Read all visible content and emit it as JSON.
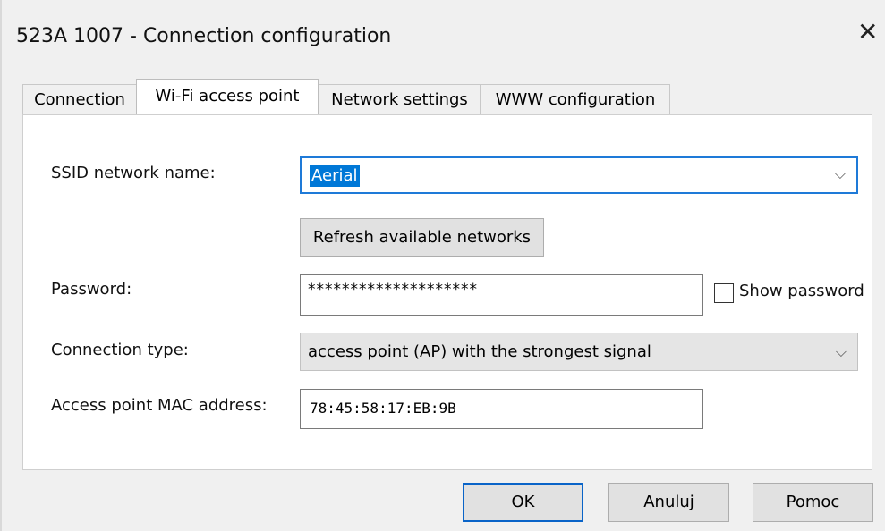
{
  "window": {
    "title": "523A 1007 - Connection configuration",
    "close_icon": "close-icon"
  },
  "tabs": [
    {
      "label": "Connection",
      "active": false
    },
    {
      "label": "Wi-Fi access point",
      "active": true
    },
    {
      "label": "Network settings",
      "active": false
    },
    {
      "label": "WWW configuration",
      "active": false
    }
  ],
  "form": {
    "ssid": {
      "label": "SSID network name:",
      "value": "Aerial"
    },
    "refresh_label": "Refresh available networks",
    "password": {
      "label": "Password:",
      "value": "********************"
    },
    "show_password": {
      "label": "Show password",
      "checked": false
    },
    "connection_type": {
      "label": "Connection type:",
      "value": "access point (AP) with the strongest signal"
    },
    "mac": {
      "label": "Access point MAC address:",
      "value": "78:45:58:17:EB:9B"
    }
  },
  "buttons": {
    "ok": "OK",
    "cancel": "Anuluj",
    "help": "Pomoc"
  },
  "colors": {
    "selection": "#0078d7",
    "focus_border": "#1e7ad8",
    "default_button_border": "#0a64c8"
  }
}
